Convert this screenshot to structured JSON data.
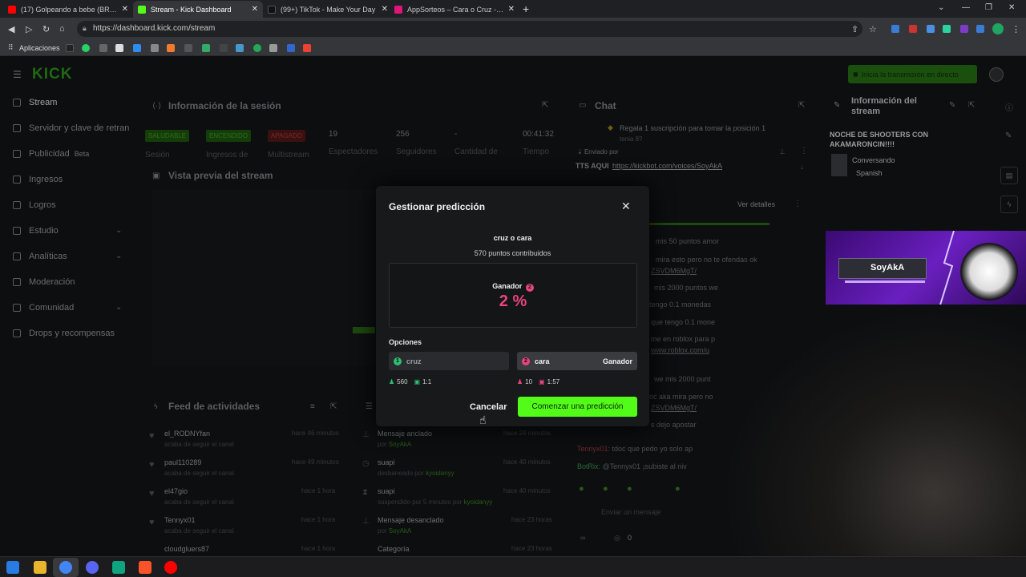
{
  "browser": {
    "tabs": [
      {
        "title": "(17) Golpeando a bebe (BROMA",
        "color": "#ff0000",
        "active": false
      },
      {
        "title": "Stream - Kick Dashboard",
        "color": "#53fc18",
        "active": true
      },
      {
        "title": "(99+) TikTok - Make Your Day",
        "color": "#000000",
        "active": false
      },
      {
        "title": "AppSorteos – Cara o Cruz - Tirar",
        "color": "#e0157c",
        "active": false
      }
    ],
    "url": "https://dashboard.kick.com/stream",
    "bookmarks_label": "Aplicaciones"
  },
  "header": {
    "logo": "KICK",
    "go_live": "Inicia la transmisión en directo"
  },
  "sidebar": {
    "items": [
      {
        "label": "Stream"
      },
      {
        "label": "Servidor y clave de retran"
      },
      {
        "label": "Publicidad",
        "tag": "Beta"
      },
      {
        "label": "Ingresos"
      },
      {
        "label": "Logros"
      },
      {
        "label": "Estudio"
      },
      {
        "label": "Analíticas"
      },
      {
        "label": "Moderación"
      },
      {
        "label": "Comunidad"
      },
      {
        "label": "Drops y recompensas"
      }
    ]
  },
  "session": {
    "title": "Información de la sesión",
    "badges": [
      "SALUDABLE",
      "ENCENDIDO",
      "APAGADO"
    ],
    "badge_labels": [
      "Sesión",
      "Ingresos de",
      "Multistream"
    ],
    "stats": [
      {
        "value": "19",
        "label": "Espectadores"
      },
      {
        "value": "256",
        "label": "Seguidores"
      },
      {
        "value": "-",
        "label": "Cantidad de"
      },
      {
        "value": "00:41:32",
        "label": "Tiempo"
      }
    ],
    "preview_title": "Vista previa del stream"
  },
  "chat": {
    "title": "Chat",
    "pinned_text": "Regala 1 suscripción para tomar la posición 1",
    "pinned_sub": "tenia 8?",
    "sent_by": "Enviado por",
    "tts_text": "TTS AQUI",
    "tts_link": "https://kickbot.com/voices/SoyAkA",
    "ver_detalles": "Ver detalles",
    "messages": [
      "mis 50 puntos amor",
      "mira esto pero no te ofendas ok",
      "ZSVDM6MgT/",
      "mis 2000 puntos we",
      "tengo 0.1 monedas",
      "que tengo 0.1 mone",
      "me en roblox para p",
      "www.roblox.com/u",
      "we mis 2000 punt",
      "oc aka mira pero no",
      "ZSVDM6MgT/",
      "s dejo apostar"
    ],
    "tennyx_name": "Tennyx01",
    "tennyx_msg": ": tdoc que pedo yo solo ap",
    "botrix_name": "BotRix",
    "botrix_msg": ": @Tennyx01 ¡subiste al niv",
    "input_placeholder": "Enviar un mensaje",
    "points": "0"
  },
  "stream_info": {
    "title": "Información del stream",
    "stream_title": "NOCHE DE SHOOTERS CON AKAMARONCIN!!!!",
    "category": "Conversando",
    "language": "Spanish",
    "overlay_name": "SoyAkA"
  },
  "feed": {
    "title": "Feed de actividades",
    "followers": [
      {
        "name": "el_RODNYfan",
        "sub": "acaba de seguir el canal",
        "time": "hace 46 minutos"
      },
      {
        "name": "paul110289",
        "sub": "acaba de seguir el canal",
        "time": "hace 49 minutos"
      },
      {
        "name": "el47gio",
        "sub": "acaba de seguir el canal",
        "time": "hace 1 hora"
      },
      {
        "name": "Tennyx01",
        "sub": "acaba de seguir el canal",
        "time": "hace 1 hora"
      },
      {
        "name": "cloudgluers87",
        "sub": "",
        "time": "hace 1 hora"
      }
    ],
    "events": [
      {
        "name": "Mensaje anclado",
        "sub": "por ",
        "by": "SoyAkA",
        "time": "hace 24 minutos"
      },
      {
        "name": "suapi",
        "sub": "desbaneado por ",
        "by": "kyoidanyy",
        "time": "hace 40 minutos"
      },
      {
        "name": "suapi",
        "sub": "suspendido por 5 minutos por ",
        "by": "kyoidanyy",
        "time": "hace 40 minutos"
      },
      {
        "name": "Mensaje desanclado",
        "sub": "por ",
        "by": "SoyAkA",
        "time": "hace 23 horas"
      },
      {
        "name": "Categoría",
        "sub": "",
        "by": "",
        "time": "hace 23 horas"
      }
    ]
  },
  "modal": {
    "title": "Gestionar predicción",
    "question": "cruz o cara",
    "points": "570 puntos contribuidos",
    "winner_label": "Ganador",
    "winner_num": "2",
    "winner_pct": "2 %",
    "options_label": "Opciones",
    "options": [
      {
        "num": "1",
        "label": "cruz",
        "users": "560",
        "ratio": "1:1",
        "color": "#2fbf71"
      },
      {
        "num": "2",
        "label": "cara",
        "users": "10",
        "ratio": "1:57",
        "color": "#e8457c",
        "winner_tag": "Ganador"
      }
    ],
    "cancel": "Cancelar",
    "start": "Comenzar una predicción"
  },
  "colors": {
    "accent": "#53fc18",
    "pink": "#e8457c",
    "green_opt": "#2fbf71"
  }
}
